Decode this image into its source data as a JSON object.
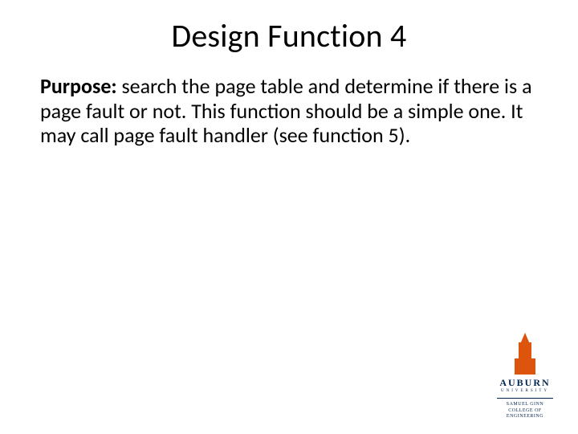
{
  "title": "Design Function 4",
  "body": {
    "label": "Purpose:",
    "text": " search the page table and determine if there is a page fault or not. This function should be a simple one. It may call page fault handler (see function 5)."
  },
  "logo": {
    "wordmark": "AUBURN",
    "university": "UNIVERSITY",
    "college_line1": "SAMUEL GINN",
    "college_line2": "COLLEGE OF ENGINEERING"
  }
}
